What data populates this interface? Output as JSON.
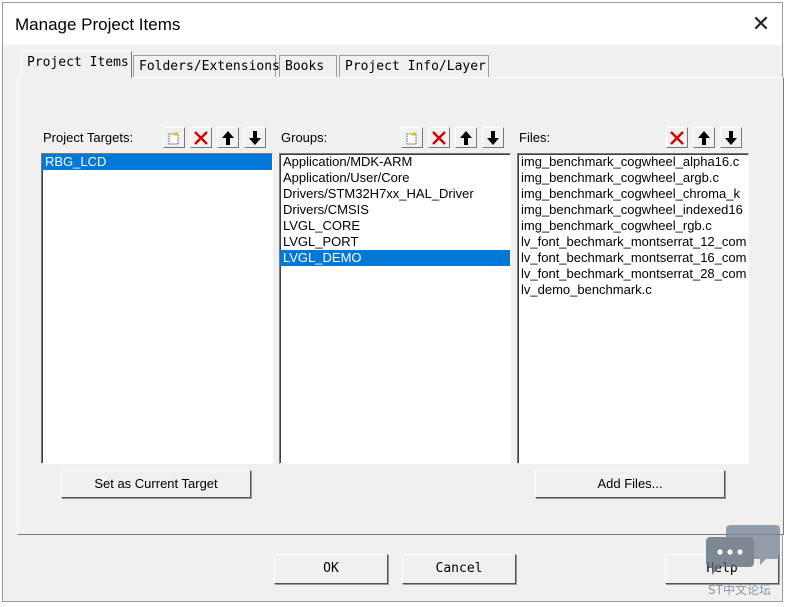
{
  "window": {
    "title": "Manage Project Items",
    "close_glyph": "✕"
  },
  "tabs": [
    {
      "label": "Project Items",
      "active": true
    },
    {
      "label": "Folders/Extensions",
      "active": false
    },
    {
      "label": "Books",
      "active": false
    },
    {
      "label": "Project Info/Layer",
      "active": false
    }
  ],
  "targets": {
    "header": "Project Targets:",
    "items": [
      "RBG_LCD"
    ],
    "selected": 0,
    "toolbar": [
      "new-icon",
      "delete-icon",
      "move-up-icon",
      "move-down-icon"
    ]
  },
  "groups": {
    "header": "Groups:",
    "items": [
      "Application/MDK-ARM",
      "Application/User/Core",
      "Drivers/STM32H7xx_HAL_Driver",
      "Drivers/CMSIS",
      "LVGL_CORE",
      "LVGL_PORT",
      "LVGL_DEMO"
    ],
    "selected": 6,
    "toolbar": [
      "new-icon",
      "delete-icon",
      "move-up-icon",
      "move-down-icon"
    ]
  },
  "files": {
    "header": "Files:",
    "items": [
      "img_benchmark_cogwheel_alpha16.c",
      "img_benchmark_cogwheel_argb.c",
      "img_benchmark_cogwheel_chroma_k",
      "img_benchmark_cogwheel_indexed16",
      "img_benchmark_cogwheel_rgb.c",
      "lv_font_bechmark_montserrat_12_com",
      "lv_font_bechmark_montserrat_16_com",
      "lv_font_bechmark_montserrat_28_com",
      "lv_demo_benchmark.c"
    ],
    "toolbar": [
      "delete-icon",
      "move-up-icon",
      "move-down-icon"
    ]
  },
  "buttons": {
    "set_target": "Set as Current Target",
    "add_files": "Add Files...",
    "ok": "OK",
    "cancel": "Cancel",
    "help": "Help"
  },
  "watermark": {
    "text": "ST中文论坛"
  },
  "colors": {
    "selection": "#0078d7",
    "delete_red": "#d40000",
    "dialog_bg": "#f0f0f0"
  }
}
